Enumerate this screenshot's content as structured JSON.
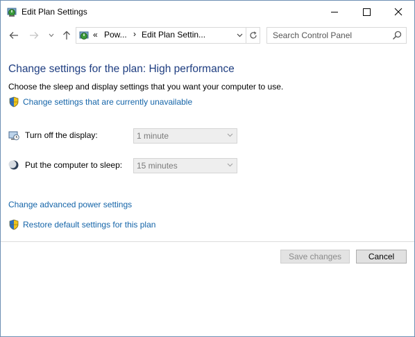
{
  "window": {
    "title": "Edit Plan Settings",
    "caption_icons": [
      "minimize-icon",
      "maximize-icon",
      "close-icon"
    ]
  },
  "nav": {
    "back_icon": "back-arrow-icon",
    "forward_icon": "forward-arrow-icon",
    "recent_icon": "chevron-down-icon",
    "up_icon": "up-arrow-icon",
    "address": {
      "overflow": "«",
      "crumbs": [
        "Pow...",
        "Edit Plan Settin..."
      ]
    },
    "search_placeholder": "Search Control Panel"
  },
  "main": {
    "heading": "Change settings for the plan: High performance",
    "description": "Choose the sleep and display settings that you want your computer to use.",
    "unavailable_link": "Change settings that are currently unavailable",
    "settings": [
      {
        "label": "Turn off the display:",
        "value": "1 minute",
        "icon": "monitor-clock-icon"
      },
      {
        "label": "Put the computer to sleep:",
        "value": "15 minutes",
        "icon": "moon-icon"
      }
    ],
    "advanced_link": "Change advanced power settings",
    "restore_link": "Restore default settings for this plan"
  },
  "buttons": {
    "save": "Save changes",
    "cancel": "Cancel"
  },
  "colors": {
    "heading": "#1e3d80",
    "link": "#1464a8",
    "disabled_text": "#8a8a8a"
  }
}
